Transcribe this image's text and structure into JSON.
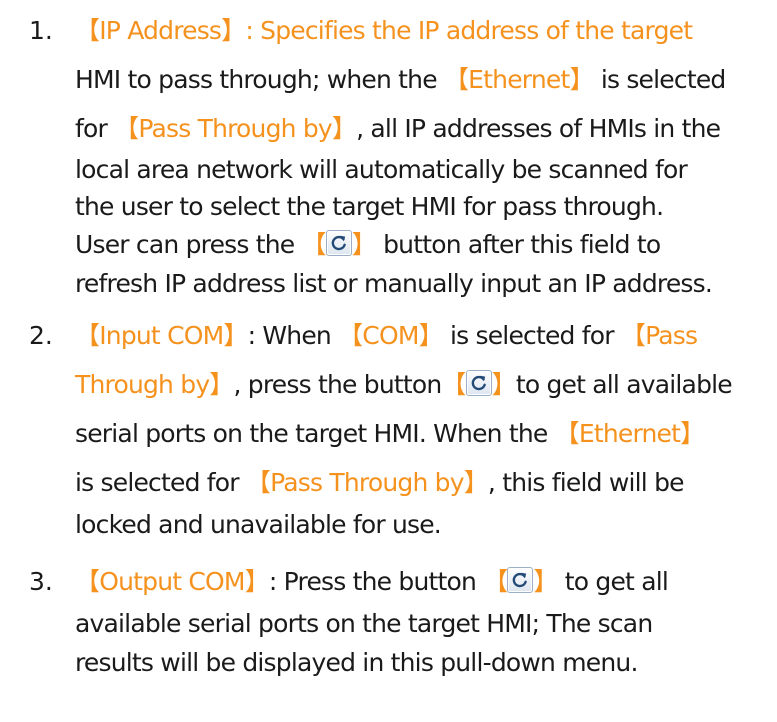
{
  "theme": {
    "keyword_color": "#f5921e",
    "text_color": "#1a1a1a",
    "icon_name": "refresh-icon"
  },
  "items": [
    {
      "number": "1.",
      "lines": [
        {
          "p1": "【",
          "k1": "IP Address",
          "p2": "】: Specifies the IP address of the target"
        },
        {
          "p1": "HMI to pass through; when the ",
          "k1": "【Ethernet】",
          "p2": " is selected"
        },
        {
          "p1": "for ",
          "k1": "【Pass Through by】",
          "p2": ", all IP addresses of HMIs in the"
        },
        {
          "p1": "local area network will automatically be scanned for"
        },
        {
          "p1": "the user to select the target HMI for pass through."
        },
        {
          "p1": "User can press the ",
          "p2": " button after this field to"
        },
        {
          "p1": "refresh IP address list or manually input an IP address."
        }
      ]
    },
    {
      "number": "2.",
      "lines": [
        {
          "k1": "【Input COM】",
          "p1": ": When ",
          "k2": "【COM】",
          "p2": " is selected for ",
          "k3": "【Pass"
        },
        {
          "k1": "Through by】",
          "p1": ", press the button",
          "p2": "to get all available"
        },
        {
          "p1": "serial ports on the target HMI. When the ",
          "k1": "【Ethernet】"
        },
        {
          "p1": "is selected for ",
          "k1": "【Pass Through by】",
          "p2": ", this field will be"
        },
        {
          "p1": "locked and unavailable for use."
        }
      ]
    },
    {
      "number": "3.",
      "lines": [
        {
          "k1": "【Output COM】",
          "p1": ": Press the button ",
          "p2": " to get all"
        },
        {
          "p1": "available serial ports on the target HMI; The scan"
        },
        {
          "p1": "results will be displayed in this pull-down menu."
        }
      ]
    }
  ]
}
